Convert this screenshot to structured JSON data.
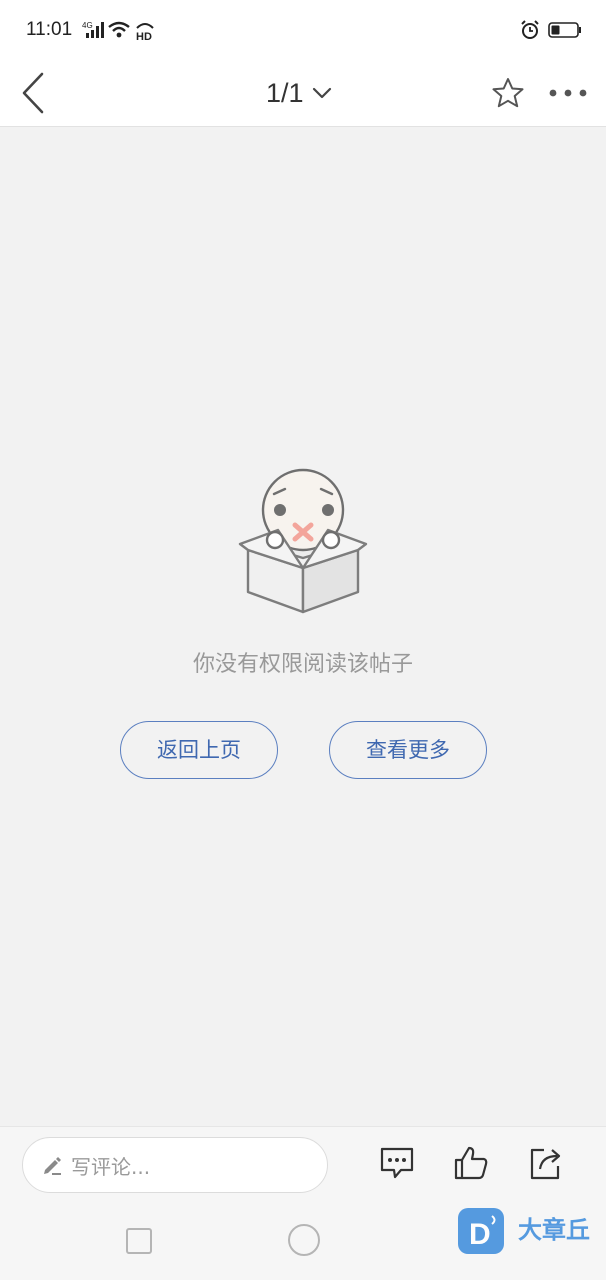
{
  "status_bar": {
    "time": "11:01",
    "network": "4G",
    "hd": "HD"
  },
  "header": {
    "page_indicator": "1/1"
  },
  "content": {
    "message": "你没有权限阅读该帖子",
    "back_button_label": "返回上页",
    "more_button_label": "查看更多"
  },
  "toolbar": {
    "comment_placeholder": "写评论..."
  },
  "watermark": {
    "text": "大章丘"
  },
  "colors": {
    "accent": "#3f68b0",
    "background": "#f2f2f2"
  },
  "icons": [
    "back-arrow-icon",
    "chevron-down-icon",
    "star-icon",
    "more-icon",
    "pen-icon",
    "comment-icon",
    "thumbs-up-icon",
    "share-icon"
  ]
}
